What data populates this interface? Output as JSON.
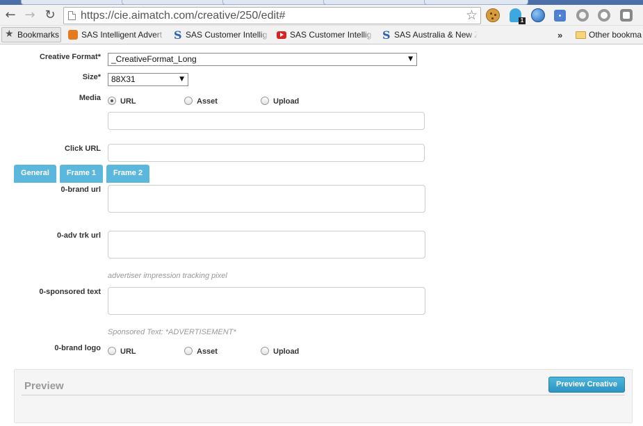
{
  "browser": {
    "url": "https://cie.aimatch.com/creative/250/edit#",
    "bookmarks": [
      {
        "label": "Bookmarks",
        "icon": "star-icon"
      },
      {
        "label": "SAS Intelligent Advert",
        "icon": "sas-orange-icon"
      },
      {
        "label": "SAS Customer Intellig",
        "icon": "sas-blue-icon"
      },
      {
        "label": "SAS Customer Intellig",
        "icon": "youtube-icon"
      },
      {
        "label": "SAS Australia & New Z",
        "icon": "sas-blue-icon"
      }
    ],
    "more_label": "»",
    "other_bookmarks": "Other bookma",
    "extension_badge": "1"
  },
  "form": {
    "creative_format": {
      "label": "Creative Format*",
      "value": "_CreativeFormat_Long"
    },
    "size": {
      "label": "Size*",
      "value": "88X31"
    },
    "media": {
      "label": "Media",
      "options": [
        "URL",
        "Asset",
        "Upload"
      ],
      "selected": "URL"
    },
    "click_url": {
      "label": "Click URL"
    },
    "tabs": [
      "General",
      "Frame 1",
      "Frame 2"
    ],
    "brand_url": {
      "label": "0-brand url"
    },
    "adv_trk_url": {
      "label": "0-adv trk url",
      "hint": "advertiser impression tracking pixel"
    },
    "sponsored_text": {
      "label": "0-sponsored text",
      "hint": "Sponsored Text: *ADVERTISEMENT*"
    },
    "brand_logo": {
      "label": "0-brand logo",
      "options": [
        "URL",
        "Asset",
        "Upload"
      ]
    }
  },
  "preview": {
    "title": "Preview",
    "button": "Preview Creative"
  }
}
